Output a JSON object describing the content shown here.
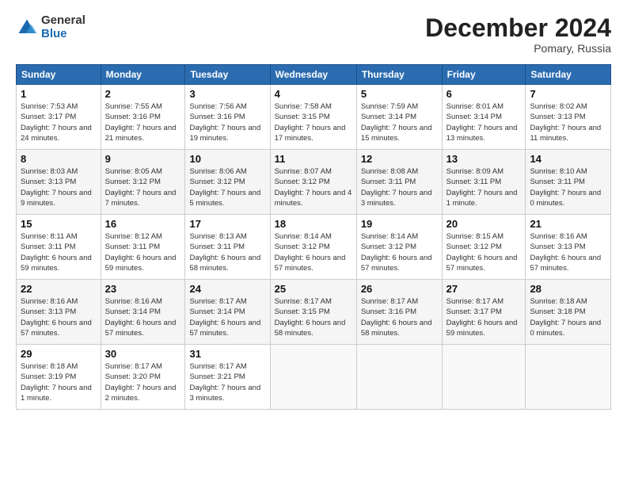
{
  "logo": {
    "general": "General",
    "blue": "Blue"
  },
  "header": {
    "title": "December 2024",
    "location": "Pomary, Russia"
  },
  "weekdays": [
    "Sunday",
    "Monday",
    "Tuesday",
    "Wednesday",
    "Thursday",
    "Friday",
    "Saturday"
  ],
  "weeks": [
    [
      {
        "day": "1",
        "sunrise": "7:53 AM",
        "sunset": "3:17 PM",
        "daylight": "7 hours and 24 minutes."
      },
      {
        "day": "2",
        "sunrise": "7:55 AM",
        "sunset": "3:16 PM",
        "daylight": "7 hours and 21 minutes."
      },
      {
        "day": "3",
        "sunrise": "7:56 AM",
        "sunset": "3:16 PM",
        "daylight": "7 hours and 19 minutes."
      },
      {
        "day": "4",
        "sunrise": "7:58 AM",
        "sunset": "3:15 PM",
        "daylight": "7 hours and 17 minutes."
      },
      {
        "day": "5",
        "sunrise": "7:59 AM",
        "sunset": "3:14 PM",
        "daylight": "7 hours and 15 minutes."
      },
      {
        "day": "6",
        "sunrise": "8:01 AM",
        "sunset": "3:14 PM",
        "daylight": "7 hours and 13 minutes."
      },
      {
        "day": "7",
        "sunrise": "8:02 AM",
        "sunset": "3:13 PM",
        "daylight": "7 hours and 11 minutes."
      }
    ],
    [
      {
        "day": "8",
        "sunrise": "8:03 AM",
        "sunset": "3:13 PM",
        "daylight": "7 hours and 9 minutes."
      },
      {
        "day": "9",
        "sunrise": "8:05 AM",
        "sunset": "3:12 PM",
        "daylight": "7 hours and 7 minutes."
      },
      {
        "day": "10",
        "sunrise": "8:06 AM",
        "sunset": "3:12 PM",
        "daylight": "7 hours and 5 minutes."
      },
      {
        "day": "11",
        "sunrise": "8:07 AM",
        "sunset": "3:12 PM",
        "daylight": "7 hours and 4 minutes."
      },
      {
        "day": "12",
        "sunrise": "8:08 AM",
        "sunset": "3:11 PM",
        "daylight": "7 hours and 3 minutes."
      },
      {
        "day": "13",
        "sunrise": "8:09 AM",
        "sunset": "3:11 PM",
        "daylight": "7 hours and 1 minute."
      },
      {
        "day": "14",
        "sunrise": "8:10 AM",
        "sunset": "3:11 PM",
        "daylight": "7 hours and 0 minutes."
      }
    ],
    [
      {
        "day": "15",
        "sunrise": "8:11 AM",
        "sunset": "3:11 PM",
        "daylight": "6 hours and 59 minutes."
      },
      {
        "day": "16",
        "sunrise": "8:12 AM",
        "sunset": "3:11 PM",
        "daylight": "6 hours and 59 minutes."
      },
      {
        "day": "17",
        "sunrise": "8:13 AM",
        "sunset": "3:11 PM",
        "daylight": "6 hours and 58 minutes."
      },
      {
        "day": "18",
        "sunrise": "8:14 AM",
        "sunset": "3:12 PM",
        "daylight": "6 hours and 57 minutes."
      },
      {
        "day": "19",
        "sunrise": "8:14 AM",
        "sunset": "3:12 PM",
        "daylight": "6 hours and 57 minutes."
      },
      {
        "day": "20",
        "sunrise": "8:15 AM",
        "sunset": "3:12 PM",
        "daylight": "6 hours and 57 minutes."
      },
      {
        "day": "21",
        "sunrise": "8:16 AM",
        "sunset": "3:13 PM",
        "daylight": "6 hours and 57 minutes."
      }
    ],
    [
      {
        "day": "22",
        "sunrise": "8:16 AM",
        "sunset": "3:13 PM",
        "daylight": "6 hours and 57 minutes."
      },
      {
        "day": "23",
        "sunrise": "8:16 AM",
        "sunset": "3:14 PM",
        "daylight": "6 hours and 57 minutes."
      },
      {
        "day": "24",
        "sunrise": "8:17 AM",
        "sunset": "3:14 PM",
        "daylight": "6 hours and 57 minutes."
      },
      {
        "day": "25",
        "sunrise": "8:17 AM",
        "sunset": "3:15 PM",
        "daylight": "6 hours and 58 minutes."
      },
      {
        "day": "26",
        "sunrise": "8:17 AM",
        "sunset": "3:16 PM",
        "daylight": "6 hours and 58 minutes."
      },
      {
        "day": "27",
        "sunrise": "8:17 AM",
        "sunset": "3:17 PM",
        "daylight": "6 hours and 59 minutes."
      },
      {
        "day": "28",
        "sunrise": "8:18 AM",
        "sunset": "3:18 PM",
        "daylight": "7 hours and 0 minutes."
      }
    ],
    [
      {
        "day": "29",
        "sunrise": "8:18 AM",
        "sunset": "3:19 PM",
        "daylight": "7 hours and 1 minute."
      },
      {
        "day": "30",
        "sunrise": "8:17 AM",
        "sunset": "3:20 PM",
        "daylight": "7 hours and 2 minutes."
      },
      {
        "day": "31",
        "sunrise": "8:17 AM",
        "sunset": "3:21 PM",
        "daylight": "7 hours and 3 minutes."
      },
      null,
      null,
      null,
      null
    ]
  ]
}
